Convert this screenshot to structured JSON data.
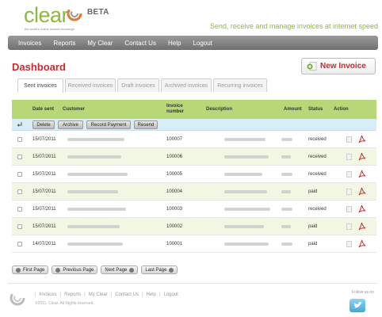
{
  "header": {
    "logo_text": "clear",
    "logo_badge": "BETA",
    "logo_tagline": "the world's online invoice exchange",
    "tagline": "Send, receive and manage invoices at internet speed"
  },
  "nav": {
    "items": [
      {
        "label": "Invoices"
      },
      {
        "label": "Reports"
      },
      {
        "label": "My Clear"
      },
      {
        "label": "Contact Us"
      },
      {
        "label": "Help"
      },
      {
        "label": "Logout"
      }
    ]
  },
  "page": {
    "title": "Dashboard",
    "new_invoice_label": "New Invoice"
  },
  "tabs": [
    {
      "label": "Sent invoices",
      "active": true
    },
    {
      "label": "Received invoices",
      "active": false
    },
    {
      "label": "Draft invoices",
      "active": false
    },
    {
      "label": "Archived invoices",
      "active": false
    },
    {
      "label": "Recurring invoices",
      "active": false
    }
  ],
  "table": {
    "headers": {
      "date_sent": "Date sent",
      "customer": "Customer",
      "invoice_number": "Invoice number",
      "description": "Description",
      "amount": "Amount",
      "status": "Status",
      "action": "Action"
    },
    "bulk_actions": [
      {
        "label": "Delete"
      },
      {
        "label": "Archive"
      },
      {
        "label": "Record Payment"
      },
      {
        "label": "Resend"
      }
    ],
    "rows": [
      {
        "date": "15/07/2011",
        "invoice": "100007",
        "status": "received"
      },
      {
        "date": "15/07/2011",
        "invoice": "100006",
        "status": "received"
      },
      {
        "date": "15/07/2011",
        "invoice": "100005",
        "status": "received"
      },
      {
        "date": "15/07/2011",
        "invoice": "100004",
        "status": "paid"
      },
      {
        "date": "15/07/2011",
        "invoice": "100003",
        "status": "received"
      },
      {
        "date": "15/07/2011",
        "invoice": "100002",
        "status": "paid"
      },
      {
        "date": "14/07/2011",
        "invoice": "100001",
        "status": "paid"
      }
    ]
  },
  "pagination": {
    "first": "First Page",
    "previous": "Previous Page",
    "next": "Next Page",
    "last": "Last Page"
  },
  "footer": {
    "links": [
      {
        "label": "Invoices"
      },
      {
        "label": "Reports"
      },
      {
        "label": "My Clear"
      },
      {
        "label": "Contact Us"
      },
      {
        "label": "Help"
      },
      {
        "label": "Logout"
      }
    ],
    "copyright": "©2011. Clear. All Rights reserved.",
    "follow": "Follow us on"
  },
  "colors": {
    "brand_green": "#8cb83c",
    "accent_red": "#cc2a2a",
    "header_green": "#b8d878",
    "row_alt": "#f1f7e2"
  },
  "icons": {
    "new_invoice": "add-document-icon",
    "document": "document-icon",
    "pdf": "pdf-icon",
    "twitter": "twitter-icon"
  }
}
